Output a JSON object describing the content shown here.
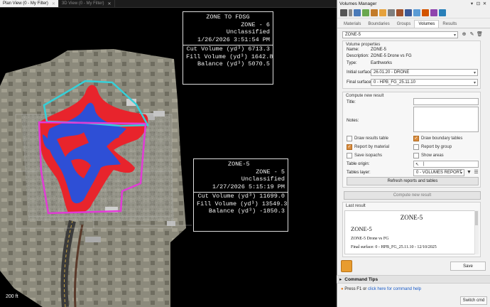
{
  "viewport": {
    "tabs": [
      {
        "label": "Plan View (0 - My Filter)",
        "active": true
      },
      {
        "label": "3D View (0 - My Filter)",
        "active": false
      }
    ],
    "close_glyph": "✕",
    "scale_label": "200 ft"
  },
  "reports": [
    {
      "header": [
        "ZONE TO FDSG",
        "ZONE - 6",
        "Unclassified",
        "1/26/2026 3:51:54 PM"
      ],
      "volumes": [
        "Cut Volume (yd³) 6713.3",
        "Fill Volume (yd³) 1642.8",
        "Balance (yd³) 5070.5"
      ]
    },
    {
      "header": [
        "ZONE-5",
        "ZONE - 5",
        "Unclassified",
        "1/27/2026 5:15:19 PM"
      ],
      "volumes": [
        "Cut Volume (yd³) 11699.0",
        "Fill Volume (yd³) 13549.3",
        "Balance (yd³) -1850.3"
      ]
    }
  ],
  "panel": {
    "title": "Volumes Manager",
    "title_buttons": {
      "dropdown": "▾",
      "pin": "⊡",
      "close": "✕"
    },
    "tabs": [
      "Materials",
      "Boundaries",
      "Groups",
      "Volumes",
      "Results"
    ],
    "active_tab": "Volumes",
    "volume_select": "ZONE-5",
    "action_glyphs": {
      "add": "⊕",
      "edit": "✎",
      "delete": "🗑",
      "dropdown": "▾"
    },
    "properties": {
      "title": "Volume properties",
      "name_label": "Name:",
      "name": "ZONE-5",
      "desc_label": "Description:",
      "description": "ZONE-5 Drone vs FG",
      "type_label": "Type:",
      "type": "Earthworks",
      "initial_label": "Initial surface",
      "initial": "26.01.20 - DRONE",
      "final_label": "Final surface",
      "final": "0 - HPB_FG_25.11.10"
    },
    "compute": {
      "title": "Compute new result",
      "title_label": "Title:",
      "notes_label": "Notes:",
      "options": [
        {
          "label": "Draw results table",
          "checked": false
        },
        {
          "label": "Draw boundary tables",
          "checked": true
        },
        {
          "label": "Report by material",
          "checked": true
        },
        {
          "label": "Report by group",
          "checked": false
        },
        {
          "label": "Save isopachs",
          "checked": false
        },
        {
          "label": "Show areas",
          "checked": false
        }
      ],
      "check_glyph": "✓",
      "origin_label": "Table origin:",
      "origin_value": "|",
      "origin_pick_glyph": "↖",
      "layer_label": "Tables layer:",
      "layer_value": "0 - VOLUMES REPORT",
      "layer_glyphs": {
        "filter": "▼",
        "manager": "☰"
      },
      "refresh_button": "Refresh reports and tables",
      "compute_button": "Compute new result"
    },
    "last_result": {
      "title": "Last result",
      "heading1": "ZONE-5",
      "heading2": "ZONE-5",
      "desc": "ZONE-5 Drone vs FG",
      "final_surface": "Final surface: 0 - HPB_FG_25.11.10 - 12/10/2025"
    },
    "save_button": "Save",
    "command_tips": {
      "title": "Command Tips",
      "toggle_glyph": "▸",
      "bullet_glyph": "●",
      "text_before": "Press F1 or ",
      "link": "click here for command help"
    },
    "switch_button": "Switch cmd"
  },
  "colors": {
    "cut": "#e8242c",
    "fill": "#2e4fd6",
    "boundary_zone6": "#36d0d8",
    "boundary_zone5": "#e23bd6",
    "accent_orange": "#d98c3e"
  }
}
